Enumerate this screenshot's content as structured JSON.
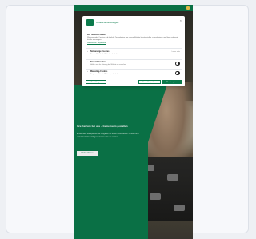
{
  "dialog": {
    "title": "Cookie-Einstellungen",
    "heading": "Wir nutzen Cookies",
    "text": "Wir verwenden Cookies und ähnliche Technologien, um unsere Website bereitzustellen, zu analysieren und Ihnen relevante Inhalte anzuzeigen.",
    "links": "Datenschutz · Impressum",
    "close_glyph": "×",
    "categories": [
      {
        "label": "Notwendige Cookies",
        "desc": "Für den Betrieb der Website erforderlich.",
        "state": "Immer aktiv",
        "control": "text"
      },
      {
        "label": "Statistik-Cookies",
        "desc": "Helfen uns, die Nutzung der Website zu verstehen.",
        "control": "toggle"
      },
      {
        "label": "Marketing-Cookies",
        "desc": "Für personalisierte Werbung und Inhalte.",
        "control": "toggle"
      }
    ],
    "buttons": {
      "settings": "Einstellungen",
      "save": "Auswahl speichern",
      "accept": "Alle akzeptieren"
    }
  },
  "hero": {
    "title": "Ihre Karriere bei uns – Gemeinsam gestalten",
    "subtitle": "Entdecken Sie spannende Aufgaben in einem innovativen Umfeld und entwickeln Sie sich gemeinsam mit uns weiter.",
    "cta": "Mehr erfahren"
  },
  "colors": {
    "brand": "#0b7a4b",
    "accent_icon": "#f2c94c"
  }
}
